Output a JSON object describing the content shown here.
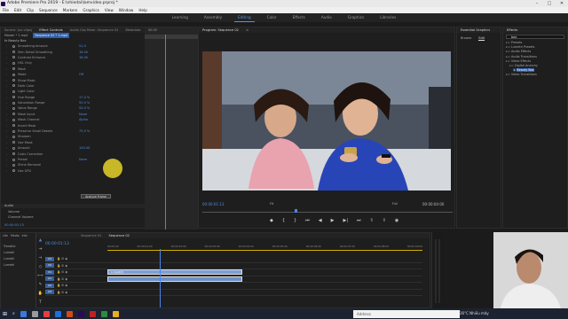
{
  "window": {
    "title": "Adobe Premiere Pro 2019 - E:\\nhiedai\\lamvideo.prproj *"
  },
  "menu": [
    "File",
    "Edit",
    "Clip",
    "Sequence",
    "Markers",
    "Graphics",
    "View",
    "Window",
    "Help"
  ],
  "workspaces": {
    "items": [
      "Learning",
      "Assembly",
      "Editing",
      "Color",
      "Effects",
      "Audio",
      "Graphics",
      "Libraries"
    ],
    "active": "Editing"
  },
  "effect_controls": {
    "tabs": [
      "Source: (no clips)",
      "Effect Controls",
      "Audio Clip Mixer: Sequence 02",
      "Metadata"
    ],
    "active_tab": "Effect Controls",
    "source_path": "Master * 1.mp4",
    "sequence_path": "Sequence 02 * 1.mp4",
    "timecode_marker": "00:00",
    "section": "Beauty Box",
    "rows": [
      {
        "label": "Smoothing Amount",
        "value": "51.0"
      },
      {
        "label": "Skin Detail Smoothing",
        "value": "18.00"
      },
      {
        "label": "Contrast Enhance",
        "value": "18.00"
      },
      {
        "label": "HSL Only",
        "value": ""
      },
      {
        "label": "Mask",
        "value": ""
      },
      {
        "label": "Mode",
        "value": "Off"
      },
      {
        "label": "Show Mask",
        "value": ""
      },
      {
        "label": "Dark Color",
        "value": ""
      },
      {
        "label": "Light Color",
        "value": ""
      },
      {
        "label": "Hue Range",
        "value": "17.0 %"
      },
      {
        "label": "Saturation Range",
        "value": "50.0 %"
      },
      {
        "label": "Value Range",
        "value": "50.0 %"
      },
      {
        "label": "Mask Input",
        "value": "None"
      },
      {
        "label": "Mask Channel",
        "value": "Alpha"
      },
      {
        "label": "Invert Mask",
        "value": ""
      },
      {
        "label": "Preserve Small Details",
        "value": "75.0 %"
      },
      {
        "label": "Sharpen",
        "value": ""
      },
      {
        "label": "Use Mask",
        "value": ""
      },
      {
        "label": "Amount",
        "value": "100.00"
      },
      {
        "label": "Color Correction",
        "value": ""
      },
      {
        "label": "Preset",
        "value": "None"
      },
      {
        "label": "Shine Removal",
        "value": ""
      },
      {
        "label": "Use GPU",
        "value": ""
      }
    ],
    "analyze_button": "Analyze Frame",
    "audio_header": "Audio",
    "audio_rows": [
      "Volume",
      "Channel Volume"
    ],
    "bottom_timecode": "00:00:01:13"
  },
  "program_monitor": {
    "title": "Program: Sequence 02",
    "timecode": "00:00:01:13",
    "fit": "Fit",
    "quality": "Full",
    "duration": "00:00:04:00"
  },
  "timeline": {
    "tabs": [
      "Sequence 01",
      "Sequence 02"
    ],
    "active_tab": "Sequence 02",
    "timecode": "00:00:01:13",
    "ruler": [
      "00:00:00",
      "00:00:01:00",
      "00:00:02:00",
      "00:00:03:00",
      "00:00:04:00",
      "00:00:05:00",
      "00:00:06:00",
      "00:00:07:00",
      "00:00:08:00",
      "00:00:09:00"
    ],
    "video_tracks": [
      "V3",
      "V2",
      "V1"
    ],
    "audio_tracks": [
      "A1",
      "A2",
      "A3"
    ],
    "clips": [
      {
        "track": "V1",
        "label": "1.mp4[V]"
      },
      {
        "track": "A1",
        "label": ""
      }
    ]
  },
  "project_panel": {
    "tabs": [
      "Libr",
      "Media",
      "Info"
    ],
    "labels": [
      "Transitio",
      "Lumetri",
      "Lumetri",
      "Lumetri"
    ]
  },
  "essential_graphics": {
    "title": "Essential Graphics",
    "tabs": [
      "Browse",
      "Edit"
    ]
  },
  "effects_panel": {
    "title": "Effects",
    "search": "bea",
    "items": [
      "Presets",
      "Lumetri Presets",
      "Audio Effects",
      "Audio Transitions",
      "Video Effects",
      "Digital Anarchy",
      "Beauty Box",
      "Video Transitions"
    ]
  },
  "taskbar": {
    "search_placeholder": "Address",
    "weather": "26°C  Nhiều mây",
    "lang": "ENG",
    "time": "11:08",
    "date": "11/05/2021"
  }
}
